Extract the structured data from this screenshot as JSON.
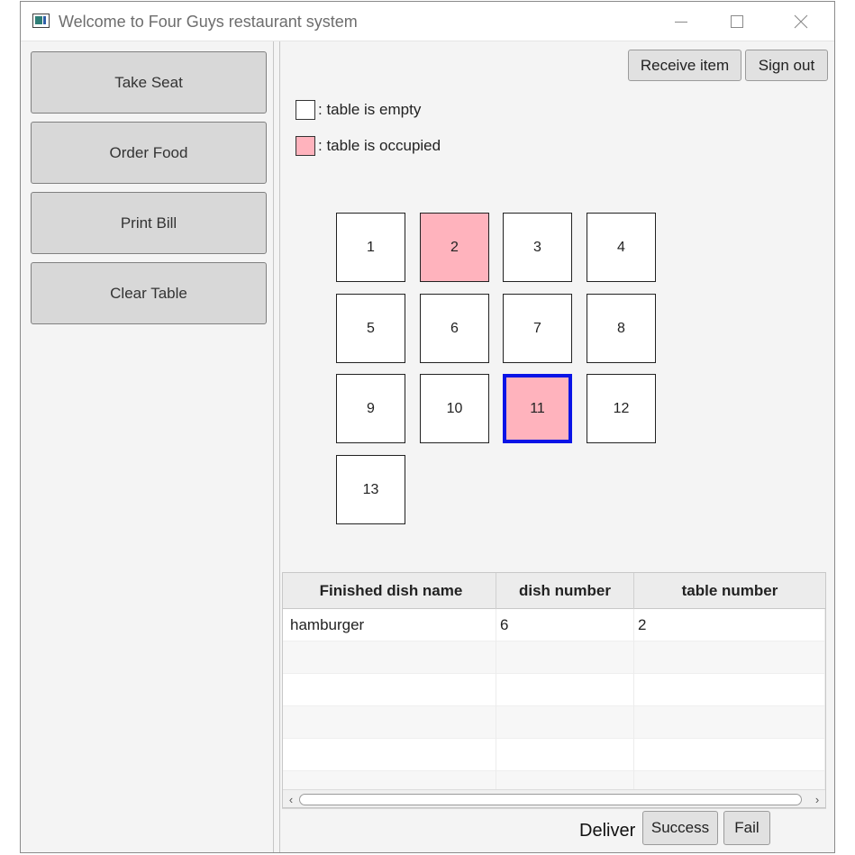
{
  "window": {
    "title": "Welcome to Four Guys restaurant system",
    "controls": [
      "minimize",
      "maximize",
      "close"
    ]
  },
  "sidebar": {
    "buttons": [
      {
        "label": "Take Seat"
      },
      {
        "label": "Order Food"
      },
      {
        "label": "Print Bill"
      },
      {
        "label": "Clear Table"
      }
    ]
  },
  "toolbar": {
    "receive_label": "Receive item",
    "signout_label": "Sign out"
  },
  "legend": {
    "empty_label": ": table is empty",
    "occupied_label": ": table is occupied",
    "empty_color": "#ffffff",
    "occupied_color": "#ffb3bd"
  },
  "tables": [
    {
      "number": "1",
      "occupied": false,
      "selected": false
    },
    {
      "number": "2",
      "occupied": true,
      "selected": false
    },
    {
      "number": "3",
      "occupied": false,
      "selected": false
    },
    {
      "number": "4",
      "occupied": false,
      "selected": false
    },
    {
      "number": "5",
      "occupied": false,
      "selected": false
    },
    {
      "number": "6",
      "occupied": false,
      "selected": false
    },
    {
      "number": "7",
      "occupied": false,
      "selected": false
    },
    {
      "number": "8",
      "occupied": false,
      "selected": false
    },
    {
      "number": "9",
      "occupied": false,
      "selected": false
    },
    {
      "number": "10",
      "occupied": false,
      "selected": false
    },
    {
      "number": "11",
      "occupied": true,
      "selected": true
    },
    {
      "number": "12",
      "occupied": false,
      "selected": false
    },
    {
      "number": "13",
      "occupied": false,
      "selected": false
    }
  ],
  "colors": {
    "selected_border": "#0a14e6"
  },
  "dishes": {
    "columns": [
      "Finished dish name",
      "dish number",
      "table number"
    ],
    "rows": [
      [
        "hamburger",
        "6",
        "2"
      ]
    ]
  },
  "deliver": {
    "label": "Deliver",
    "success_label": "Success",
    "fail_label": "Fail"
  }
}
